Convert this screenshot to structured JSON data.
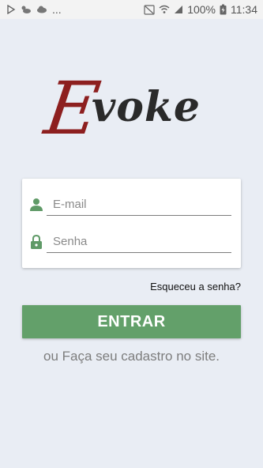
{
  "status_bar": {
    "more_indicator": "...",
    "battery_percent": "100%",
    "time": "11:34"
  },
  "logo": {
    "first_letter": "E",
    "rest": "voke"
  },
  "login": {
    "email_placeholder": "E-mail",
    "password_placeholder": "Senha",
    "forgot_password": "Esqueceu a senha?",
    "enter_button": "ENTRAR",
    "signup_text": "ou Faça seu cadastro no site."
  },
  "colors": {
    "background": "#e9edf4",
    "accent_green": "#63a06a",
    "logo_red": "#8d1f1f"
  }
}
